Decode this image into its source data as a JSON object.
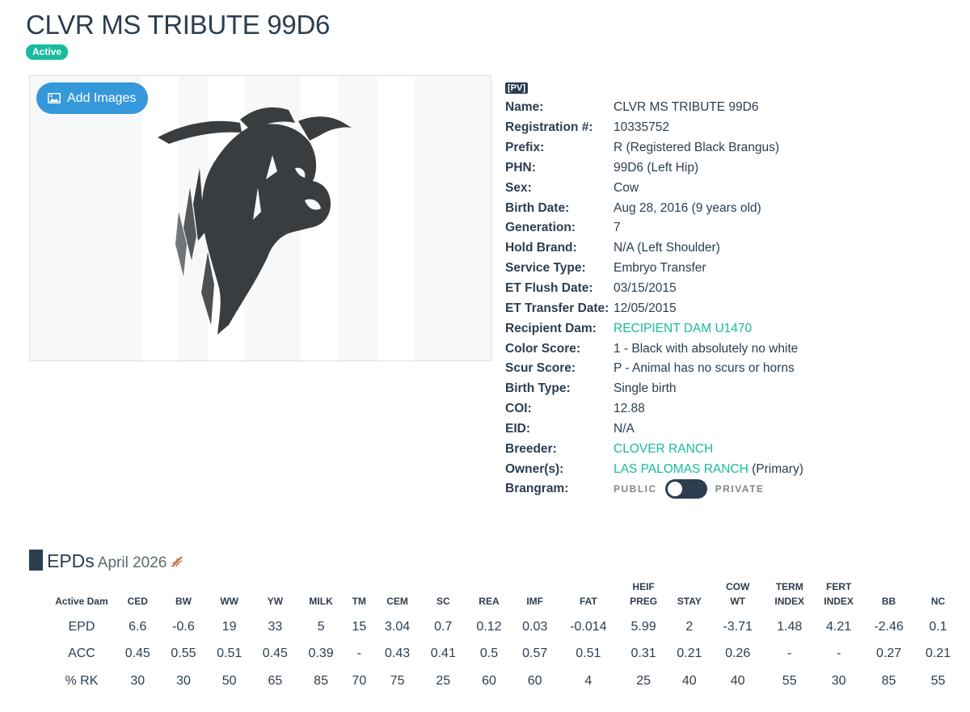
{
  "header": {
    "title": "CLVR MS TRIBUTE 99D6",
    "status": "Active"
  },
  "gallery": {
    "add_images_label": "Add Images"
  },
  "details": {
    "tag": "[PV]",
    "rows": [
      {
        "label": "Name:",
        "value": "CLVR MS TRIBUTE 99D6"
      },
      {
        "label": "Registration #:",
        "value": "10335752"
      },
      {
        "label": "Prefix:",
        "value": "R (Registered Black Brangus)"
      },
      {
        "label": "PHN:",
        "value": "99D6 (Left Hip)"
      },
      {
        "label": "Sex:",
        "value": "Cow"
      },
      {
        "label": "Birth Date:",
        "value": "Aug 28, 2016 (9 years old)"
      },
      {
        "label": "Generation:",
        "value": "7"
      },
      {
        "label": "Hold Brand:",
        "value": "N/A (Left Shoulder)"
      },
      {
        "label": "Service Type:",
        "value": "Embryo Transfer"
      },
      {
        "label": "ET Flush Date:",
        "value": "03/15/2015"
      },
      {
        "label": "ET Transfer Date:",
        "value": "12/05/2015"
      },
      {
        "label": "Recipient Dam:",
        "link": "RECIPIENT DAM U1470"
      },
      {
        "label": "Color Score:",
        "value": "1 - Black with absolutely no white"
      },
      {
        "label": "Scur Score:",
        "value": "P - Animal has no scurs or horns"
      },
      {
        "label": "Birth Type:",
        "value": "Single birth"
      },
      {
        "label": "COI:",
        "value": "12.88"
      },
      {
        "label": "EID:",
        "value": "N/A"
      },
      {
        "label": "Breeder:",
        "link": "CLOVER RANCH"
      },
      {
        "label": "Owner(s):",
        "link": "LAS PALOMAS RANCH",
        "suffix": "(Primary)"
      }
    ],
    "brangram": {
      "label": "Brangram:",
      "public_label": "PUBLIC",
      "private_label": "PRIVATE",
      "state": "PUBLIC"
    }
  },
  "epds": {
    "title": "EPDs",
    "date": "April 2026",
    "columns": [
      "Active Dam",
      "CED",
      "BW",
      "WW",
      "YW",
      "MILK",
      "TM",
      "CEM",
      "SC",
      "REA",
      "IMF",
      "FAT",
      "HEIF PREG",
      "STAY",
      "COW WT",
      "TERM INDEX",
      "FERT INDEX",
      "BB",
      "NC"
    ],
    "rows": [
      [
        "EPD",
        "6.6",
        "-0.6",
        "19",
        "33",
        "5",
        "15",
        "3.04",
        "0.7",
        "0.12",
        "0.03",
        "-0.014",
        "5.99",
        "2",
        "-3.71",
        "1.48",
        "4.21",
        "-2.46",
        "0.1"
      ],
      [
        "ACC",
        "0.45",
        "0.55",
        "0.51",
        "0.45",
        "0.39",
        "-",
        "0.43",
        "0.41",
        "0.5",
        "0.57",
        "0.51",
        "0.31",
        "0.21",
        "0.26",
        "-",
        "-",
        "0.27",
        "0.21"
      ],
      [
        "% RK",
        "30",
        "30",
        "50",
        "65",
        "85",
        "70",
        "75",
        "25",
        "60",
        "60",
        "4",
        "25",
        "40",
        "40",
        "55",
        "30",
        "85",
        "55"
      ]
    ]
  },
  "colors": {
    "primary": "#2c3e50",
    "accent": "#18bc9c",
    "button": "#3498db"
  }
}
